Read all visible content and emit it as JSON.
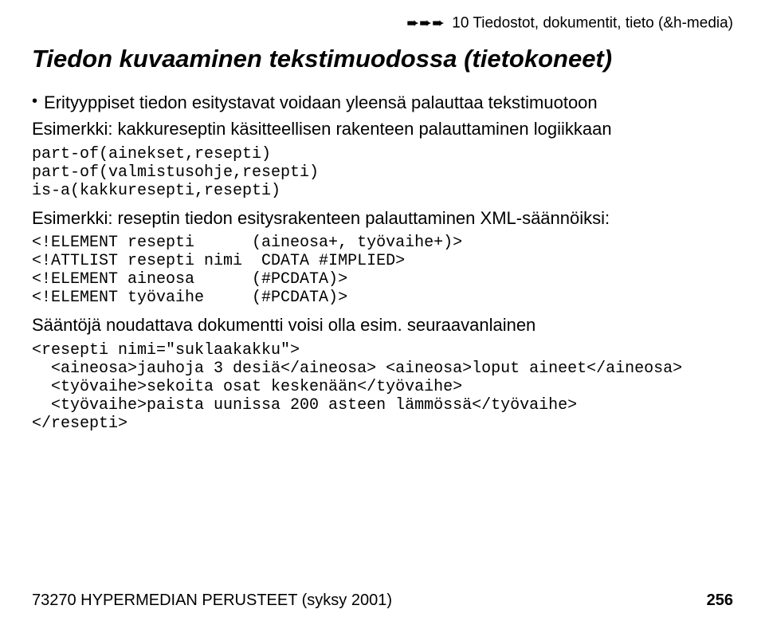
{
  "header": {
    "crumb": "10 Tiedostot, dokumentit, tieto (&h-media)"
  },
  "title": "Tiedon kuvaaminen tekstimuodossa (tietokoneet)",
  "bullet": "Erityyppiset tiedon esitystavat voidaan yleensä palauttaa tekstimuotoon",
  "ex1": {
    "label": "Esimerkki: kakkureseptin käsitteellisen rakenteen palauttaminen logiikkaan",
    "code": "part-of(ainekset,resepti)\npart-of(valmistusohje,resepti)\nis-a(kakkuresepti,resepti)"
  },
  "ex2": {
    "label": "Esimerkki: reseptin tiedon esitysrakenteen palauttaminen XML-säännöiksi:",
    "code": "<!ELEMENT resepti      (aineosa+, työvaihe+)>\n<!ATTLIST resepti nimi  CDATA #IMPLIED>\n<!ELEMENT aineosa      (#PCDATA)>\n<!ELEMENT työvaihe     (#PCDATA)>"
  },
  "body_line": "Sääntöjä noudattava dokumentti voisi olla esim. seuraavanlainen",
  "ex3": {
    "code": "<resepti nimi=\"suklaakakku\">\n  <aineosa>jauhoja 3 desiä</aineosa> <aineosa>loput aineet</aineosa>\n  <työvaihe>sekoita osat keskenään</työvaihe>\n  <työvaihe>paista uunissa 200 asteen lämmössä</työvaihe>\n</resepti>"
  },
  "footer": {
    "left": "73270 HYPERMEDIAN PERUSTEET (syksy 2001)",
    "page": "256"
  }
}
